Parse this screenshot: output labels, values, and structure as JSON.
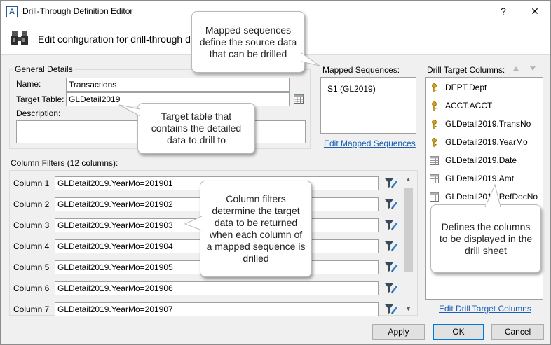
{
  "window": {
    "title": "Drill-Through Definition Editor",
    "help_glyph": "?",
    "close_glyph": "✕"
  },
  "header": {
    "text": "Edit configuration for drill-through d"
  },
  "general": {
    "title": "General Details",
    "name_label": "Name:",
    "name_value": "Transactions",
    "target_table_label": "Target Table:",
    "target_table_value": "GLDetail2019",
    "description_label": "Description:",
    "description_value": ""
  },
  "mapped": {
    "title": "Mapped Sequences:",
    "items": [
      "S1 (GL2019)"
    ],
    "edit_link": "Edit Mapped Sequences"
  },
  "drill_target": {
    "title": "Drill Target Columns:",
    "items": [
      {
        "label": "DEPT.Dept",
        "icon": "key-icon"
      },
      {
        "label": "ACCT.ACCT",
        "icon": "key-icon"
      },
      {
        "label": "GLDetail2019.TransNo",
        "icon": "key-icon"
      },
      {
        "label": "GLDetail2019.YearMo",
        "icon": "key-icon"
      },
      {
        "label": "GLDetail2019.Date",
        "icon": "grid-icon"
      },
      {
        "label": "GLDetail2019.Amt",
        "icon": "grid-icon"
      },
      {
        "label": "GLDetail2019.RefDocNo",
        "icon": "grid-icon"
      }
    ],
    "edit_link": "Edit Drill Target Columns"
  },
  "filters": {
    "title": "Column Filters (12 columns):",
    "rows": [
      {
        "label": "Column 1",
        "value": "GLDetail2019.YearMo=201901"
      },
      {
        "label": "Column 2",
        "value": "GLDetail2019.YearMo=201902"
      },
      {
        "label": "Column 3",
        "value": "GLDetail2019.YearMo=201903"
      },
      {
        "label": "Column 4",
        "value": "GLDetail2019.YearMo=201904"
      },
      {
        "label": "Column 5",
        "value": "GLDetail2019.YearMo=201905"
      },
      {
        "label": "Column 6",
        "value": "GLDetail2019.YearMo=201906"
      },
      {
        "label": "Column 7",
        "value": "GLDetail2019.YearMo=201907"
      }
    ]
  },
  "buttons": {
    "apply": "Apply",
    "ok": "OK",
    "cancel": "Cancel"
  },
  "callouts": {
    "mapped": "Mapped sequences define the source data that can be drilled",
    "target_table": "Target table that contains the detailed data to drill to",
    "filters": "Column filters determine the target data to be returned when each column of a mapped sequence is drilled",
    "drill_target": "Defines the columns to be displayed in the drill sheet"
  },
  "colors": {
    "accent": "#0078d7",
    "link": "#1a5fb4",
    "key_gold": "#d4a017"
  }
}
